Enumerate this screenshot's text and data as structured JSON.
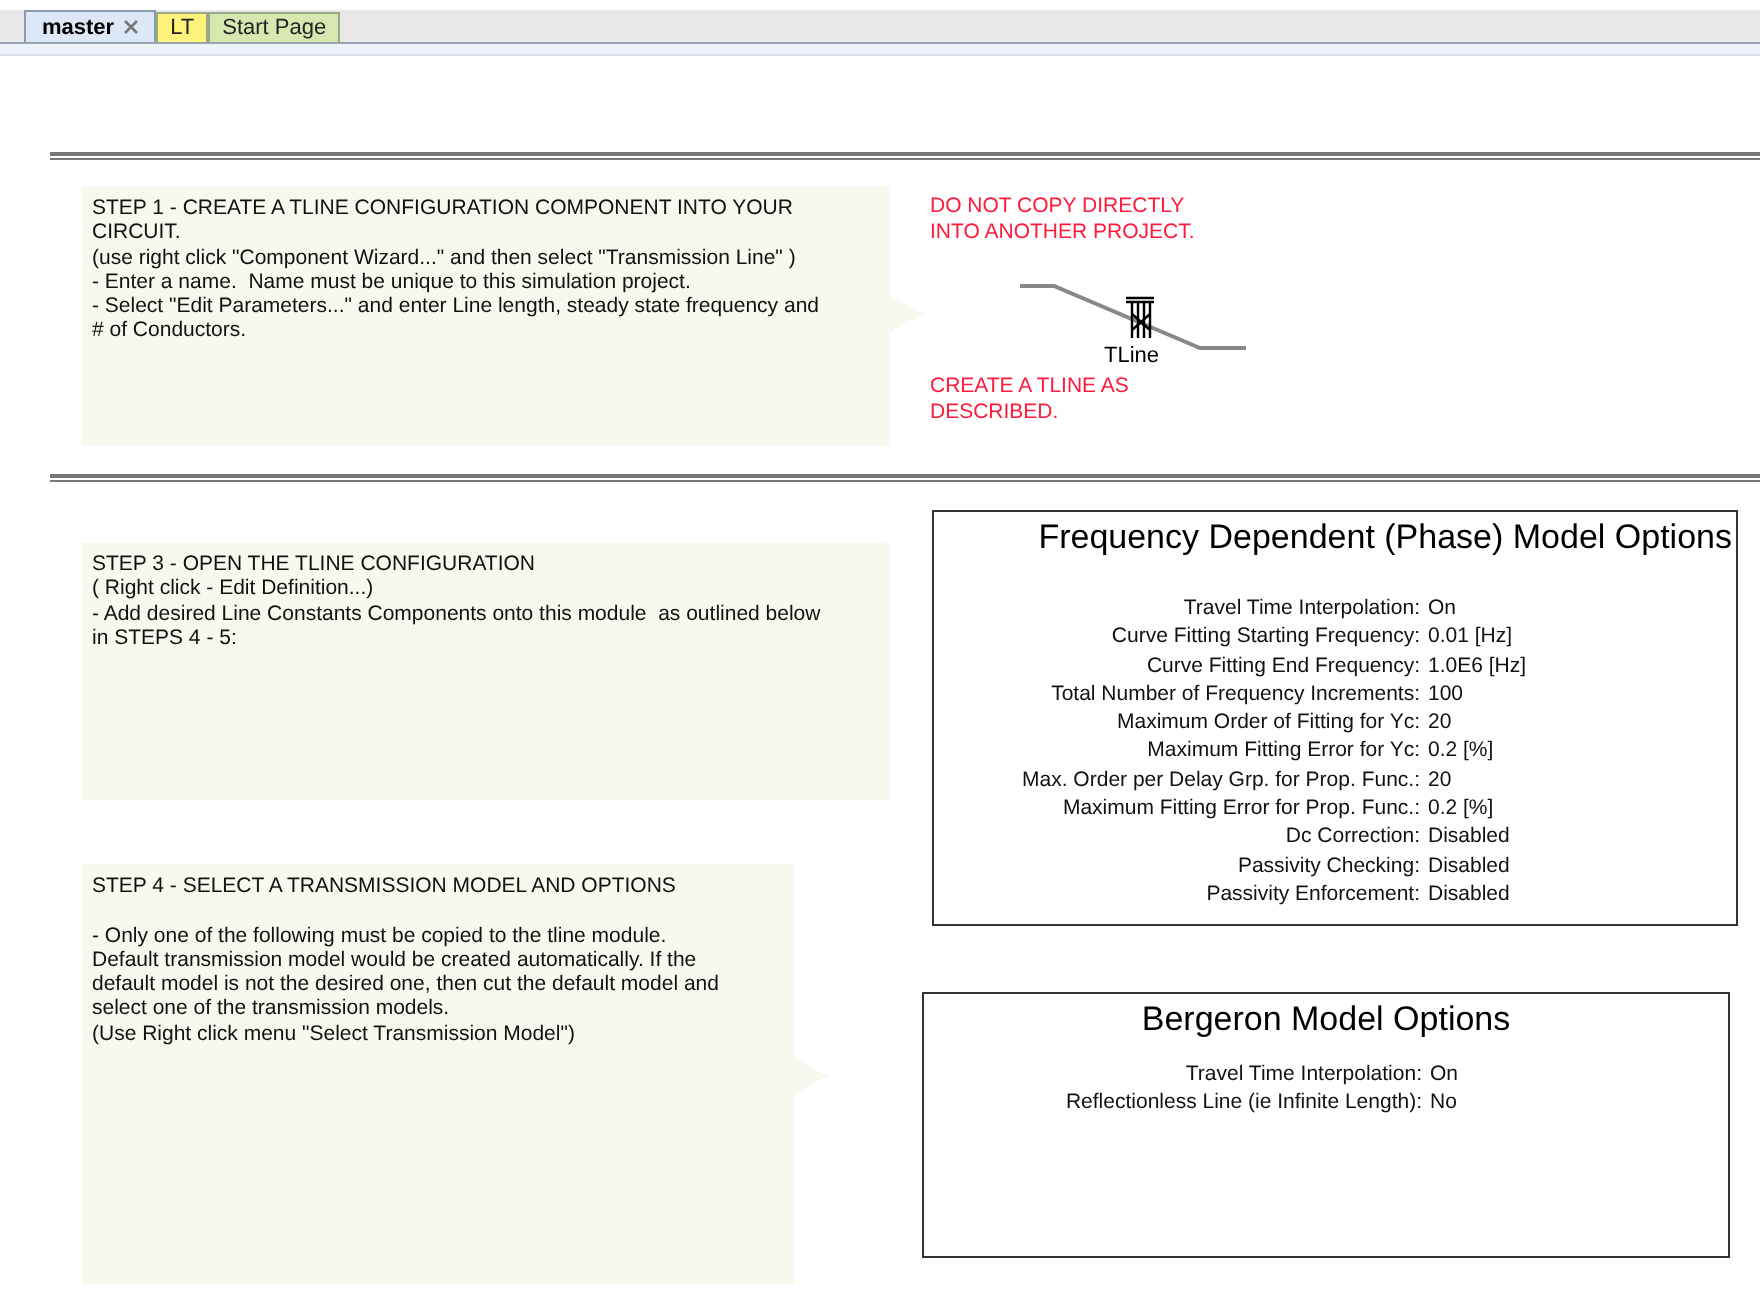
{
  "tabs": [
    {
      "label": "master",
      "selected": true,
      "closable": true,
      "color": "#dce8f8"
    },
    {
      "label": "LT",
      "selected": false,
      "closable": false,
      "color": "#fff27a"
    },
    {
      "label": "Start Page",
      "selected": false,
      "closable": false,
      "color": "#d6e8b0"
    }
  ],
  "notes": [
    {
      "text": "STEP 1 - CREATE A TLINE CONFIGURATION COMPONENT INTO YOUR\nCIRCUIT.\n(use right click \"Component Wizard...\" and then select \"Transmission Line\" )\n- Enter a name.  Name must be unique to this simulation project.\n- Select \"Edit Parameters...\" and enter Line length, steady state frequency and\n# of Conductors."
    },
    {
      "text": "STEP 3 - OPEN THE TLINE CONFIGURATION\n( Right click - Edit Definition...)\n- Add desired Line Constants Components onto this module  as outlined below\nin STEPS 4 - 5:"
    },
    {
      "text": "STEP 4 - SELECT A TRANSMISSION MODEL AND OPTIONS\n\n- Only one of the following must be copied to the tline module.\nDefault transmission model would be created automatically. If the\ndefault model is not the desired one, then cut the default model and\nselect one of the transmission models.\n(Use Right click menu \"Select Transmission Model\")"
    }
  ],
  "warnings": [
    "DO NOT COPY DIRECTLY\nINTO ANOTHER PROJECT.",
    "CREATE A TLINE AS\nDESCRIBED."
  ],
  "component": {
    "label": "TLine"
  },
  "model_boxes": [
    {
      "title": "Frequency Dependent (Phase) Model Options",
      "options": [
        {
          "label": "Travel Time Interpolation:",
          "value": "On"
        },
        {
          "label": "Curve Fitting Starting Frequency:",
          "value": "0.01 [Hz]"
        },
        {
          "label": "Curve Fitting End Frequency:",
          "value": "1.0E6 [Hz]"
        },
        {
          "label": "Total Number of Frequency Increments:",
          "value": "100"
        },
        {
          "label": "Maximum Order of Fitting for Yc:",
          "value": "20"
        },
        {
          "label": "Maximum Fitting Error for Yc:",
          "value": "0.2 [%]"
        },
        {
          "label": "Max. Order per Delay Grp. for Prop. Func.:",
          "value": "20"
        },
        {
          "label": "Maximum Fitting Error for Prop. Func.:",
          "value": "0.2 [%]"
        },
        {
          "label": "Dc Correction:",
          "value": "Disabled"
        },
        {
          "label": "Passivity Checking:",
          "value": "Disabled"
        },
        {
          "label": "Passivity Enforcement:",
          "value": "Disabled"
        }
      ]
    },
    {
      "title": "Bergeron Model Options",
      "options": [
        {
          "label": "Travel Time Interpolation:",
          "value": "On"
        },
        {
          "label": "Reflectionless Line (ie Infinite Length):",
          "value": "No"
        }
      ]
    }
  ]
}
